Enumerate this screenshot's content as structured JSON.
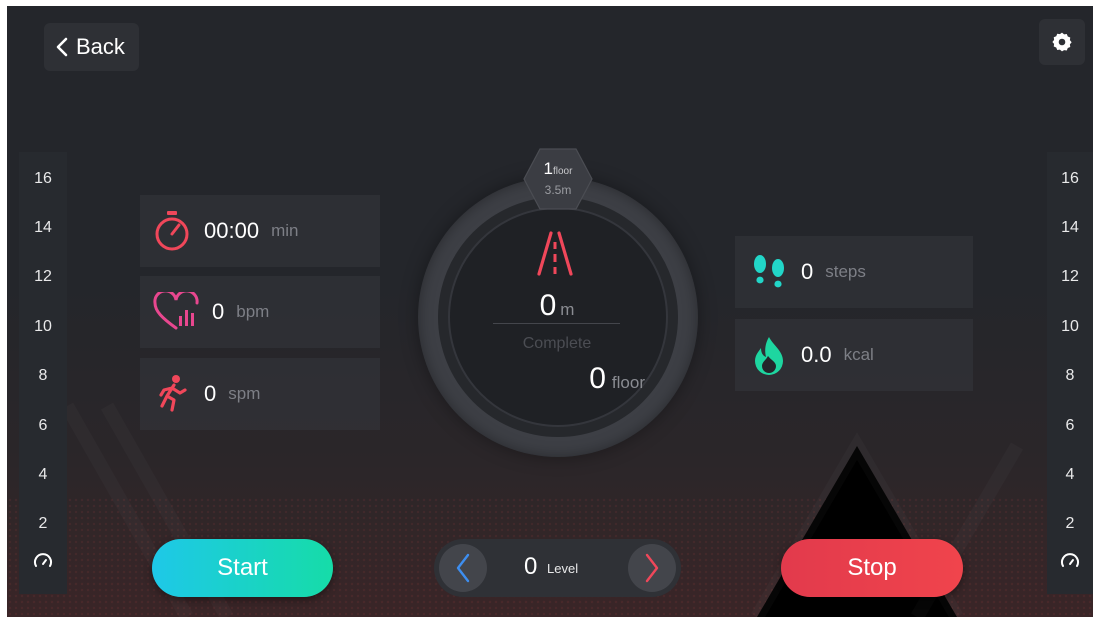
{
  "header": {
    "back_label": "Back"
  },
  "scale": {
    "ticks": [
      "16",
      "14",
      "12",
      "10",
      "8",
      "6",
      "4",
      "2"
    ]
  },
  "stats_left": {
    "time": {
      "value": "00:00",
      "unit": "min"
    },
    "heart_rate": {
      "value": "0",
      "unit": "bpm"
    },
    "cadence": {
      "value": "0",
      "unit": "spm"
    }
  },
  "stats_right": {
    "steps": {
      "value": "0",
      "unit": "steps"
    },
    "calories": {
      "value": "0.0",
      "unit": "kcal"
    }
  },
  "center": {
    "badge_number": "1",
    "badge_unit": "floor",
    "badge_height": "3.5m",
    "distance_value": "0",
    "distance_unit": "m",
    "complete_label": "Complete",
    "floors_value": "0",
    "floors_unit": "floor"
  },
  "controls": {
    "start_label": "Start",
    "stop_label": "Stop",
    "level_value": "0",
    "level_label": "Level"
  },
  "colors": {
    "accent_pink": "#f0475a",
    "accent_green": "#1ed6a0",
    "accent_cyan": "#1ec8e8",
    "arrow_blue": "#3d8ef0",
    "arrow_red": "#f0475a"
  }
}
